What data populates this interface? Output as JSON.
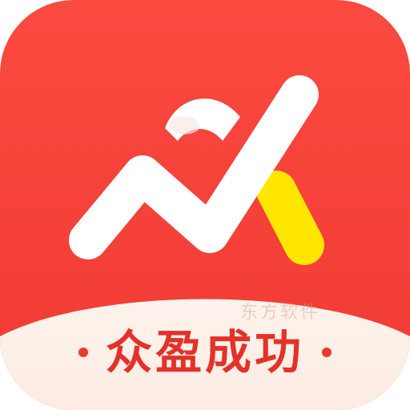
{
  "app": {
    "name": "众盈成功",
    "watermark": "东方软件"
  },
  "icon": {
    "shape": "rounded-square",
    "logo": "mountain-check-mark-icon",
    "colors": {
      "background_top": "#fb4a40",
      "background_bottom": "#f03a33",
      "mark": "#ffffff",
      "accent": "#ffe600",
      "banner": "#fdf1ea",
      "text": "#e2322a",
      "dot": "#e93a30"
    }
  }
}
